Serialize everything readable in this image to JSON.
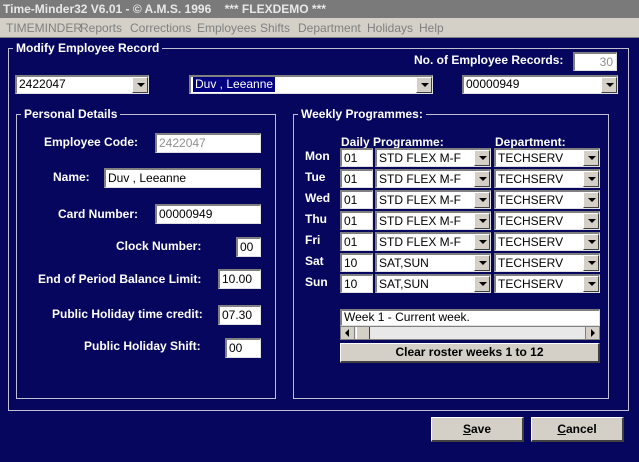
{
  "window": {
    "title": "Time-Minder32 V6.01 - © A.M.S. 1996    *** FLEXDEMO ***"
  },
  "menu": [
    "TIMEMINDER",
    "Reports",
    "Corrections",
    "Employees",
    "Shifts",
    "Department",
    "Holidays",
    "Help"
  ],
  "modify": {
    "legend": "Modify Employee Record",
    "records_label": "No. of Employee Records:",
    "records_value": "30",
    "employee_code_select": "2422047",
    "name_select": "Duv       , Leeanne",
    "card_select": "00000949"
  },
  "personal": {
    "legend": "Personal Details",
    "employee_code_label": "Employee Code:",
    "employee_code": "2422047",
    "name_label": "Name:",
    "name": "Duv        , Leeanne",
    "card_label": "Card Number:",
    "card": "00000949",
    "clock_label": "Clock Number:",
    "clock": "00",
    "eop_label": "End of Period Balance Limit:",
    "eop": "10.00",
    "ph_credit_label": "Public Holiday time credit:",
    "ph_credit": "07.30",
    "ph_shift_label": "Public Holiday Shift:",
    "ph_shift": "00"
  },
  "weekly": {
    "legend": "Weekly Programmes:",
    "daily_header": "Daily Programme:",
    "dept_header": "Department:",
    "rows": [
      {
        "day": "Mon",
        "code": "01",
        "programme": "STD FLEX M-F",
        "department": "TECHSERV"
      },
      {
        "day": "Tue",
        "code": "01",
        "programme": "STD FLEX M-F",
        "department": "TECHSERV"
      },
      {
        "day": "Wed",
        "code": "01",
        "programme": "STD FLEX M-F",
        "department": "TECHSERV"
      },
      {
        "day": "Thu",
        "code": "01",
        "programme": "STD FLEX M-F",
        "department": "TECHSERV"
      },
      {
        "day": "Fri",
        "code": "01",
        "programme": "STD FLEX M-F",
        "department": "TECHSERV"
      },
      {
        "day": "Sat",
        "code": "10",
        "programme": "SAT,SUN",
        "department": "TECHSERV"
      },
      {
        "day": "Sun",
        "code": "10",
        "programme": "SAT,SUN",
        "department": "TECHSERV"
      }
    ],
    "week_text": "Week  1 - Current week.",
    "clear_label": "Clear roster weeks 1 to 12"
  },
  "buttons": {
    "save_prefix": "S",
    "save_rest": "ave",
    "cancel_prefix": "C",
    "cancel_rest": "ancel"
  }
}
